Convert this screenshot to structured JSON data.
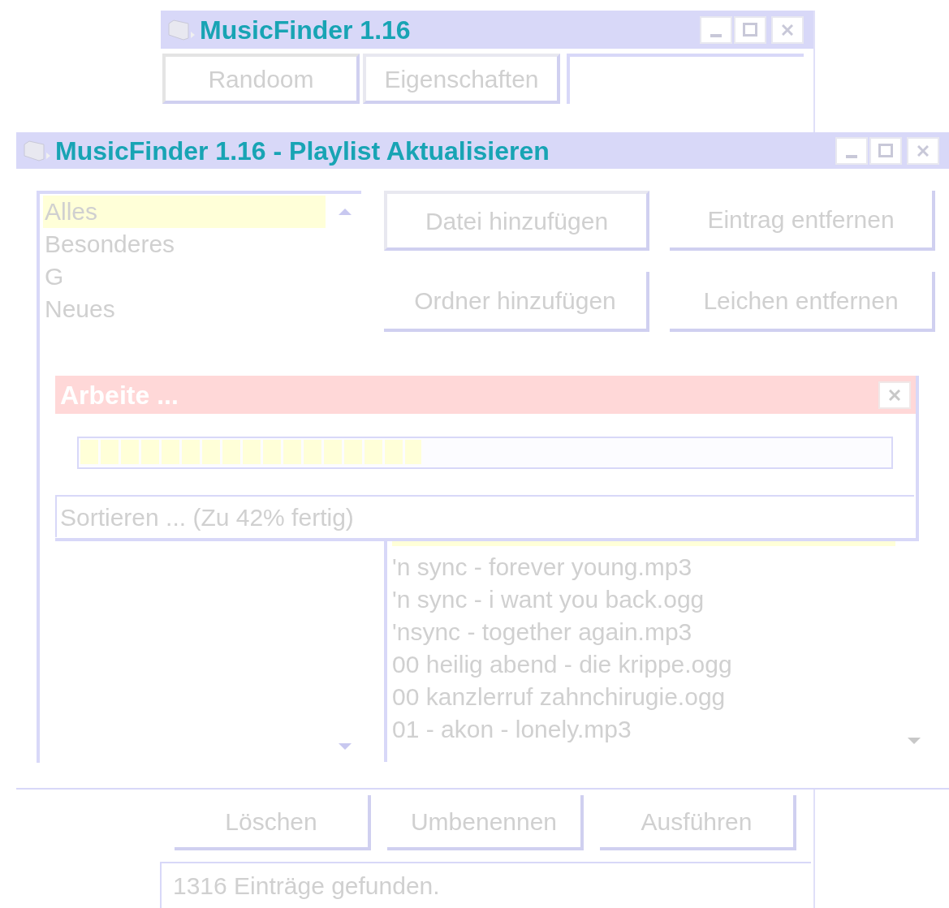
{
  "main_window": {
    "title": "MusicFinder 1.16",
    "top_buttons": [
      "Randoom",
      "Eigenschaften"
    ],
    "bottom_buttons": [
      "Löschen",
      "Umbenennen",
      "Ausführen"
    ],
    "status": "1316 Einträge gefunden."
  },
  "playlist_window": {
    "title": "MusicFinder 1.16 - Playlist Aktualisieren",
    "categories": [
      {
        "label": "Alles",
        "selected": true
      },
      {
        "label": "Besonderes",
        "selected": false
      },
      {
        "label": "G",
        "selected": false
      },
      {
        "label": "Neues",
        "selected": false
      }
    ],
    "buttons": [
      "Datei hinzufügen",
      "Eintrag entfernen",
      "Ordner hinzufügen",
      "Leichen entfernen"
    ],
    "files": [
      "'n sync - forever young.mp3",
      "'n sync - i want you back.ogg",
      "'nsync - together again.mp3",
      "00 heilig abend - die krippe.ogg",
      "00 kanzlerruf zahnchirugie.ogg",
      "01 - akon - lonely.mp3"
    ]
  },
  "progress_dialog": {
    "title": "Arbeite ...",
    "level": 0.42,
    "message": "Sortieren ... (Zu 42% fertig)"
  }
}
